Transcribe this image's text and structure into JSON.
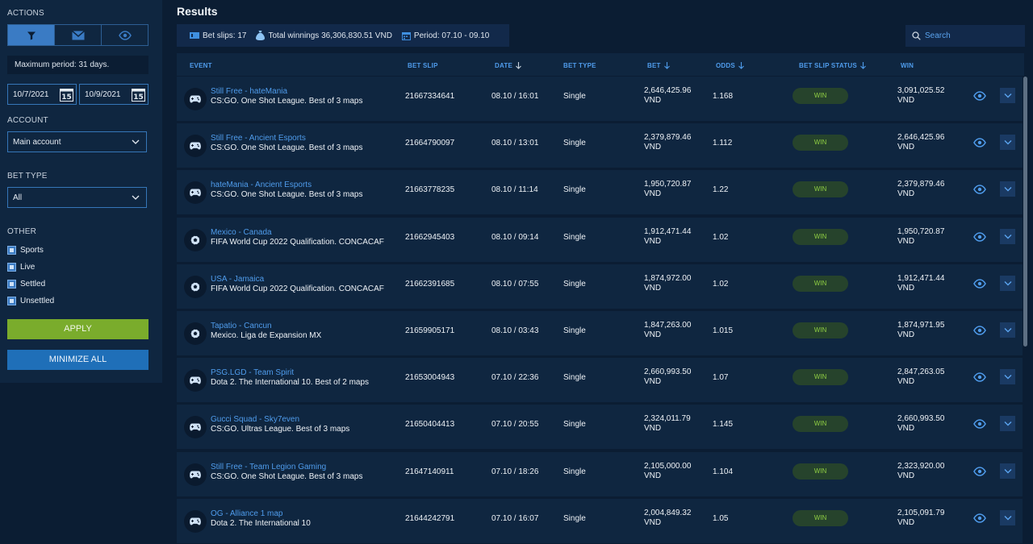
{
  "sidebar": {
    "actions_label": "ACTIONS",
    "max_period": "Maximum period: 31 days.",
    "date_from": "10/7/2021",
    "date_to": "10/9/2021",
    "calendar_day": "15",
    "account_label": "ACCOUNT",
    "account_value": "Main account",
    "bet_type_label": "BET TYPE",
    "bet_type_value": "All",
    "other_label": "OTHER",
    "checks": [
      {
        "label": "Sports",
        "checked": true
      },
      {
        "label": "Live",
        "checked": true
      },
      {
        "label": "Settled",
        "checked": true
      },
      {
        "label": "Unsettled",
        "checked": true
      }
    ],
    "apply_label": "APPLY",
    "minimize_label": "MINIMIZE ALL"
  },
  "main": {
    "title": "Results",
    "summary": {
      "bet_slips": "Bet slips: 17",
      "total_winnings": "Total winnings 36,306,830.51 VND",
      "period": "Period: 07.10 - 09.10"
    },
    "search_placeholder": "Search",
    "columns": {
      "event": "EVENT",
      "bet_slip": "BET SLIP",
      "date": "DATE",
      "bet_type": "BET TYPE",
      "bet": "BET",
      "odds": "ODDS",
      "status": "BET SLIP STATUS",
      "win": "WIN"
    },
    "currency": "VND",
    "rows": [
      {
        "icon": "gamepad",
        "title": "Still Free - hateMania",
        "league": "CS:GO. One Shot League. Best of 3 maps",
        "slip": "21667334641",
        "date": "08.10 / 16:01",
        "type": "Single",
        "bet": "2,646,425.96",
        "odds": "1.168",
        "status": "WIN",
        "win": "3,091,025.52"
      },
      {
        "icon": "gamepad",
        "title": "Still Free - Ancient Esports",
        "league": "CS:GO. One Shot League. Best of 3 maps",
        "slip": "21664790097",
        "date": "08.10 / 13:01",
        "type": "Single",
        "bet": "2,379,879.46",
        "odds": "1.112",
        "status": "WIN",
        "win": "2,646,425.96"
      },
      {
        "icon": "gamepad",
        "title": "hateMania - Ancient Esports",
        "league": "CS:GO. One Shot League. Best of 3 maps",
        "slip": "21663778235",
        "date": "08.10 / 11:14",
        "type": "Single",
        "bet": "1,950,720.87",
        "odds": "1.22",
        "status": "WIN",
        "win": "2,379,879.46"
      },
      {
        "icon": "soccer",
        "title": "Mexico - Canada",
        "league": "FIFA World Cup 2022 Qualification. CONCACAF",
        "slip": "21662945403",
        "date": "08.10 / 09:14",
        "type": "Single",
        "bet": "1,912,471.44",
        "odds": "1.02",
        "status": "WIN",
        "win": "1,950,720.87"
      },
      {
        "icon": "soccer",
        "title": "USA - Jamaica",
        "league": "FIFA World Cup 2022 Qualification. CONCACAF",
        "slip": "21662391685",
        "date": "08.10 / 07:55",
        "type": "Single",
        "bet": "1,874,972.00",
        "odds": "1.02",
        "status": "WIN",
        "win": "1,912,471.44"
      },
      {
        "icon": "soccer",
        "title": "Tapatio - Cancun",
        "league": "Mexico. Liga de Expansion MX",
        "slip": "21659905171",
        "date": "08.10 / 03:43",
        "type": "Single",
        "bet": "1,847,263.00",
        "odds": "1.015",
        "status": "WIN",
        "win": "1,874,971.95"
      },
      {
        "icon": "gamepad",
        "title": "PSG.LGD - Team Spirit",
        "league": "Dota 2. The International 10. Best of 2 maps",
        "slip": "21653004943",
        "date": "07.10 / 22:36",
        "type": "Single",
        "bet": "2,660,993.50",
        "odds": "1.07",
        "status": "WIN",
        "win": "2,847,263.05"
      },
      {
        "icon": "gamepad",
        "title": "Gucci Squad - Sky7even",
        "league": "CS:GO. Ultras League. Best of 3 maps",
        "slip": "21650404413",
        "date": "07.10 / 20:55",
        "type": "Single",
        "bet": "2,324,011.79",
        "odds": "1.145",
        "status": "WIN",
        "win": "2,660,993.50"
      },
      {
        "icon": "gamepad",
        "title": "Still Free - Team Legion Gaming",
        "league": "CS:GO. One Shot League. Best of 3 maps",
        "slip": "21647140911",
        "date": "07.10 / 18:26",
        "type": "Single",
        "bet": "2,105,000.00",
        "odds": "1.104",
        "status": "WIN",
        "win": "2,323,920.00"
      },
      {
        "icon": "gamepad",
        "title": "OG - Alliance 1 map",
        "league": "Dota 2. The International 10",
        "slip": "21644242791",
        "date": "07.10 / 16:07",
        "type": "Single",
        "bet": "2,004,849.32",
        "odds": "1.05",
        "status": "WIN",
        "win": "2,105,091.79"
      }
    ]
  },
  "colors": {
    "accent_blue": "#4f9cec",
    "apply_green": "#7aac2c",
    "minimize_blue": "#1f6fb8",
    "win_badge_text": "#8fcf43",
    "win_badge_bg": "#26432c"
  }
}
